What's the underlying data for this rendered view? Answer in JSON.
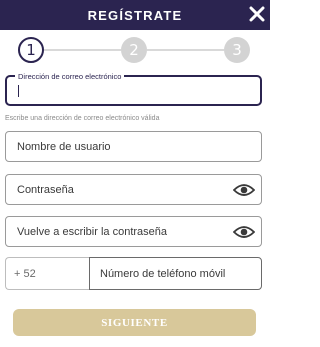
{
  "header": {
    "title": "REGÍSTRATE",
    "close_icon": "close-icon"
  },
  "stepper": {
    "steps": [
      "1",
      "2",
      "3"
    ],
    "active": 1
  },
  "email": {
    "label": "Dirección de correo electrónico",
    "value": "",
    "helper": "Escribe una dirección de correo electrónico válida"
  },
  "username": {
    "placeholder": "Nombre de usuario"
  },
  "password": {
    "placeholder": "Contraseña",
    "icon": "eye-icon"
  },
  "password_confirm": {
    "placeholder": "Vuelve a escribir la contraseña",
    "icon": "eye-icon"
  },
  "phone": {
    "country_code": "+ 52",
    "placeholder": "Número de teléfono móvil"
  },
  "submit": {
    "label": "SIGUIENTE"
  },
  "colors": {
    "primary": "#2b2450",
    "button": "#d8c89a",
    "step_inactive": "#d3d3d3"
  }
}
